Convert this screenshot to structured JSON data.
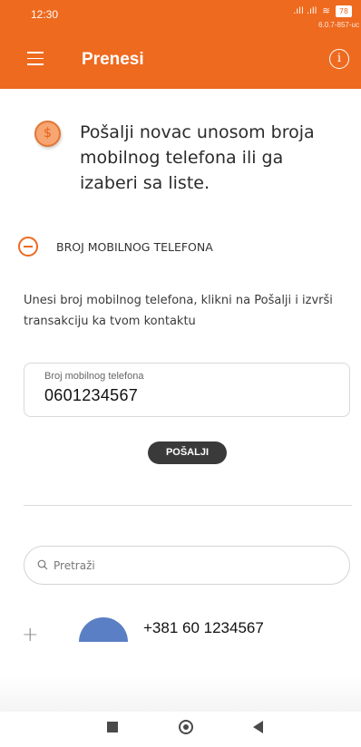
{
  "status_bar": {
    "time": "12:30",
    "signal": ".ıll .ıll",
    "wifi": "≋",
    "battery": "78",
    "version": "6.0.7-857-uc"
  },
  "header": {
    "title": "Prenesi",
    "menu_icon": "hamburger-icon",
    "info_icon": "info-icon",
    "info_glyph": "i",
    "accent_color": "#ee6a1f"
  },
  "intro": {
    "icon": "coin-icon",
    "icon_glyph": "$",
    "text": "Pošalji novac unosom broja mobilnog telefona ili ga izaberi sa liste."
  },
  "section": {
    "title": "BROJ MOBILNOG TELEFONA",
    "instruction": "Unesi broj mobilnog telefona, klikni na Pošalji i izvrši transakciju ka tvom kontaktu"
  },
  "phone_field": {
    "label": "Broj mobilnog telefona",
    "value": "0601234567"
  },
  "send_button": {
    "label": "POŠALJI"
  },
  "search": {
    "placeholder": "Pretraži"
  },
  "contacts": [
    {
      "number": "+381 60 1234567",
      "add_glyph": "+",
      "avatar_color": "#5b7fc4"
    }
  ]
}
